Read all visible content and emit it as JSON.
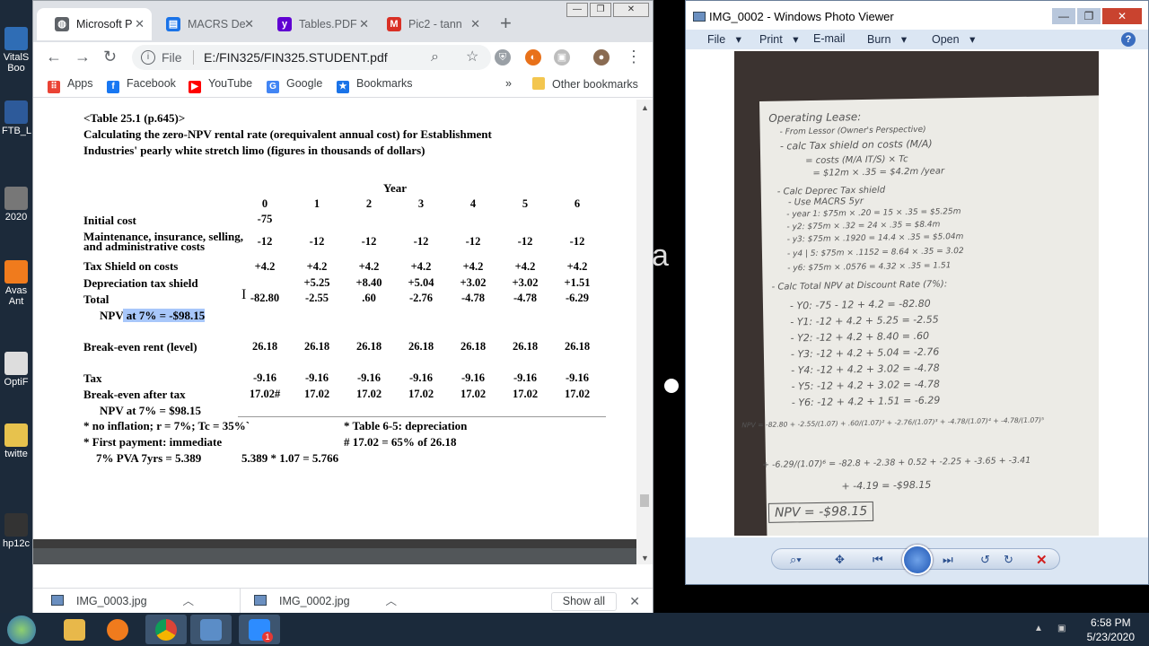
{
  "desktop": {
    "icons": [
      {
        "label": "VitalS Boo",
        "color": "#2f6db5"
      },
      {
        "label": "FTB_L",
        "color": "#2d5a9a"
      },
      {
        "label": "2020",
        "color": "#777"
      },
      {
        "label": "Avas Ant",
        "color": "#f07b1d"
      },
      {
        "label": "OptiF",
        "color": "#ddd"
      },
      {
        "label": "twitte",
        "color": "#e7c24d"
      },
      {
        "label": "hp12c",
        "color": "#333"
      }
    ]
  },
  "browser": {
    "tabs": [
      {
        "title": "Microsoft P",
        "icon": "globe-icon",
        "color": "#5f6368",
        "active": true
      },
      {
        "title": "MACRS De",
        "icon": "document-icon",
        "color": "#1a73e8",
        "active": false
      },
      {
        "title": "Tables.PDF",
        "icon": "yahoo-icon",
        "color": "#6001d2",
        "active": false
      },
      {
        "title": "Pic2 - tann",
        "icon": "gmail-icon",
        "color": "#d93025",
        "active": false
      }
    ],
    "new_tab": "+",
    "address": {
      "scheme": "File",
      "url": "E:/FIN325/FIN325.STUDENT.pdf"
    },
    "bookmarks": [
      {
        "label": "Apps",
        "icon": "apps-grid-icon",
        "color": "#ea4335"
      },
      {
        "label": "Facebook",
        "icon": "facebook-icon",
        "color": "#1877f2"
      },
      {
        "label": "YouTube",
        "icon": "youtube-icon",
        "color": "#ff0000"
      },
      {
        "label": "Google",
        "icon": "google-icon",
        "color": "#4285f4"
      },
      {
        "label": "Bookmarks",
        "icon": "star-icon",
        "color": "#1a73e8"
      }
    ],
    "bookmarks_overflow": "»",
    "other_bookmarks": "Other bookmarks"
  },
  "pdf": {
    "caption": "<Table 25.1 (p.645)>",
    "title_line1": "Calculating the zero-NPV rental rate (orequivalent annual cost) for Establishment",
    "title_line2": "Industries' pearly white stretch limo (figures in thousands of dollars)",
    "year_label": "Year",
    "years": [
      "0",
      "1",
      "2",
      "3",
      "4",
      "5",
      "6"
    ],
    "rows": [
      {
        "label": "Initial cost",
        "values": [
          "-75",
          "",
          "",
          "",
          "",
          "",
          ""
        ]
      },
      {
        "label": "Maintenance, insurance, selling, and administrative costs",
        "label_line1": "Maintenance, insurance, selling,",
        "label_line2": "and administrative costs",
        "values": [
          "-12",
          "-12",
          "-12",
          "-12",
          "-12",
          "-12",
          "-12"
        ]
      },
      {
        "label": "Tax Shield on costs",
        "values": [
          "+4.2",
          "+4.2",
          "+4.2",
          "+4.2",
          "+4.2",
          "+4.2",
          "+4.2"
        ]
      },
      {
        "label": "Depreciation tax shield",
        "values": [
          "",
          "+5.25",
          "+8.40",
          "+5.04",
          "+3.02",
          "+3.02",
          "+1.51"
        ]
      },
      {
        "label": "Total",
        "values": [
          "-82.80",
          "-2.55",
          ".60",
          "-2.76",
          "-4.78",
          "-4.78",
          "-6.29"
        ]
      }
    ],
    "npv_line_prefix": "NPV",
    "npv_line_selected": " at 7% = -$98.15",
    "breakeven_label": "Break-even rent (level)",
    "breakeven_values": [
      "26.18",
      "26.18",
      "26.18",
      "26.18",
      "26.18",
      "26.18",
      "26.18"
    ],
    "tax_label": "Tax",
    "tax_values": [
      "-9.16",
      "-9.16",
      "-9.16",
      "-9.16",
      "-9.16",
      "-9.16",
      "-9.16"
    ],
    "after_tax_label": "Break-even after tax",
    "after_tax_values": [
      "17.02#",
      "17.02",
      "17.02",
      "17.02",
      "17.02",
      "17.02",
      "17.02"
    ],
    "npv2": "NPV at 7% = $98.15",
    "note1": "* no inflation; r = 7%; Tc = 35%`",
    "note2": "* First payment: immediate",
    "note3": "7% PVA 7yrs = 5.389",
    "note4": "5.389 * 1.07 = 5.766",
    "note5": "* Table 6-5: depreciation",
    "note6": "# 17.02 = 65% of 26.18"
  },
  "downloads": {
    "items": [
      "IMG_0003.jpg",
      "IMG_0002.jpg"
    ],
    "show_all": "Show all"
  },
  "overlay": {
    "fragment": "a"
  },
  "photo_viewer": {
    "title": "IMG_0002 - Windows Photo Viewer",
    "menu": [
      "File",
      "Print",
      "E-mail",
      "Burn",
      "Open"
    ],
    "handwriting": [
      "Operating Lease:",
      "- From Lessor (Owner's Perspective)",
      "- calc Tax shield on costs (M/A)",
      "= costs (M/A IT/S) × Tc",
      "= $12m × .35 = $4.2m /year",
      "- Calc Deprec Tax shield",
      "- Use MACRS 5yr",
      "- year 1: $75m × .20 = 15 × .35 = $5.25m",
      "- y2: $75m × .32 = 24 × .35 = $8.4m",
      "- y3: $75m × .1920 = 14.4 × .35 = $5.04m",
      "- y4 | 5: $75m × .1152 = 8.64 × .35 = 3.02",
      "- y6: $75m × .0576 = 4.32 × .35 = 1.51",
      "- Calc Total NPV at Discount Rate (7%):",
      "- Y0: -75 - 12 + 4.2 = -82.80",
      "- Y1: -12 + 4.2 + 5.25 = -2.55",
      "- Y2: -12 + 4.2 + 8.40 = .60",
      "- Y3: -12 + 4.2 + 5.04 = -2.76",
      "- Y4: -12 + 4.2 + 3.02 = -4.78",
      "- Y5: -12 + 4.2 + 3.02 = -4.78",
      "- Y6: -12 + 4.2 + 1.51 = -6.29",
      "NPV = -82.80 + -2.55/(1.07) + .60/(1.07)² + -2.76/(1.07)³ + -4.78/(1.07)⁴ + -4.78/(1.07)⁵",
      "+ -6.29/(1.07)⁶ = -82.8 + -2.38 + 0.52 + -2.25 + -3.65 + -3.41",
      "+ -4.19 = -$98.15",
      "NPV = -$98.15"
    ]
  },
  "taskbar": {
    "apps": [
      {
        "name": "file-explorer",
        "color": "#e8b84a"
      },
      {
        "name": "media-player",
        "color": "#f07b1d"
      },
      {
        "name": "chrome",
        "color": "#db4437"
      },
      {
        "name": "photo-viewer",
        "color": "#5b8dc7"
      },
      {
        "name": "zoom",
        "color": "#2d8cff"
      }
    ],
    "zoom_badge": "1",
    "time": "6:58 PM",
    "date": "5/23/2020"
  }
}
